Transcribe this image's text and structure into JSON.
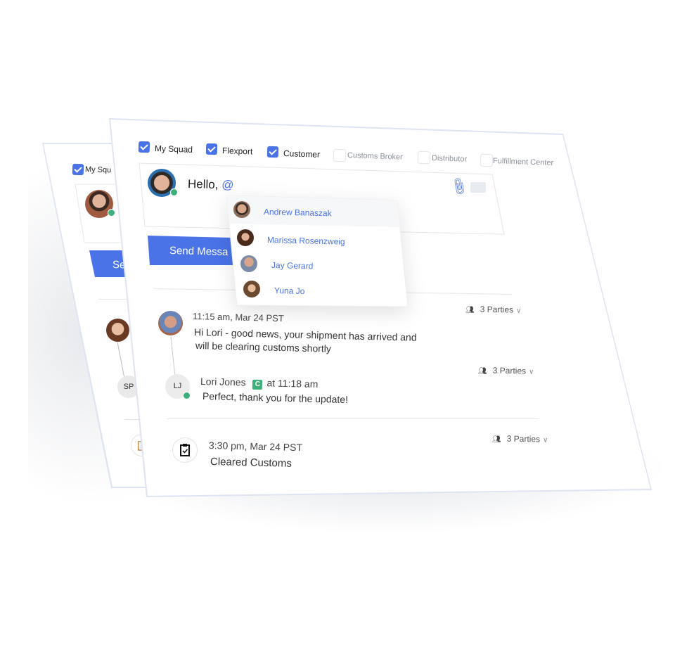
{
  "filters": [
    {
      "label": "My Squad",
      "checked": true
    },
    {
      "label": "Flexport",
      "checked": true
    },
    {
      "label": "Customer",
      "checked": true
    },
    {
      "label": "Customs Broker",
      "checked": false
    },
    {
      "label": "Distributor",
      "checked": false
    },
    {
      "label": "Fulfillment Center",
      "checked": false
    }
  ],
  "composer": {
    "text": "Hello,",
    "mention_trigger": "@",
    "icons": [
      "paperclip-icon",
      "comment-icon"
    ]
  },
  "send_button": {
    "label": "Send Messa"
  },
  "mention_dropdown": {
    "items": [
      {
        "name": "Andrew Banaszak",
        "highlighted": true
      },
      {
        "name": "Marissa Rosenzweig"
      },
      {
        "name": "Jay Gerard"
      },
      {
        "name": "Yuna Jo"
      }
    ]
  },
  "messages": [
    {
      "time": "11:15 am, Mar 24 PST",
      "line1": "Hi Lori - good news, your shipment has arrived and",
      "line2": "will be clearing customs shortly",
      "parties": "3 Parties"
    },
    {
      "initials": "LJ",
      "author": "Lori Jones",
      "badge": "C",
      "time": "at 11:18 am",
      "text": "Perfect, thank you for the update!",
      "parties": "3 Parties"
    },
    {
      "time": "3:30 pm, Mar 24 PST",
      "text": "Cleared Customs",
      "parties": "3 Parties"
    }
  ],
  "back_card": {
    "filter_label": "My Squ",
    "send_label": "Se",
    "initials": "SP"
  },
  "colors": {
    "accent": "#4a73e8",
    "online": "#3eb17a",
    "badge": "#3eb17a"
  }
}
